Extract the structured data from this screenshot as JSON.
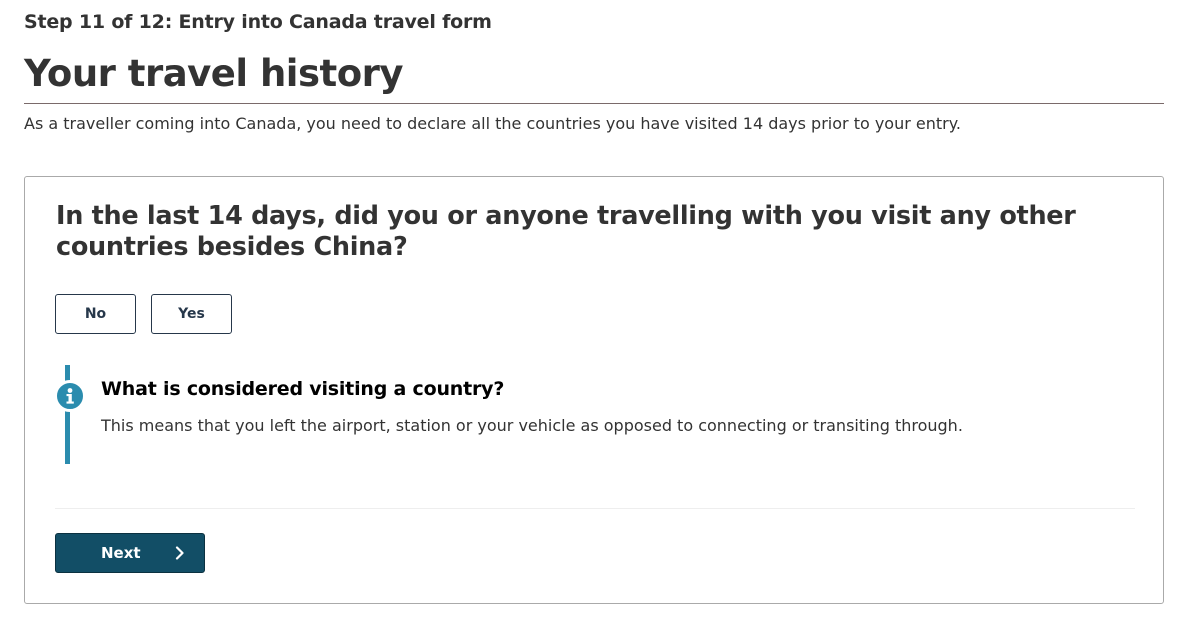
{
  "header": {
    "step": "Step 11 of 12: Entry into Canada travel form",
    "title": "Your travel history",
    "intro": "As a traveller coming into Canada, you need to declare all the countries you have visited 14 days prior to your entry."
  },
  "question": {
    "text": "In the last 14 days, did you or anyone travelling with you visit any other countries besides China?",
    "options": [
      {
        "label": "No"
      },
      {
        "label": "Yes"
      }
    ]
  },
  "info": {
    "icon": "info-icon",
    "heading": "What is considered visiting a country?",
    "text": "This means that you left the airport, station or your vehicle as opposed to connecting or transiting through."
  },
  "actions": {
    "next_label": "Next",
    "next_icon": "chevron-right-icon"
  },
  "colors": {
    "text": "#333333",
    "button_border": "#26374a",
    "info_accent": "#2b8cae",
    "primary_button": "#124e66"
  }
}
